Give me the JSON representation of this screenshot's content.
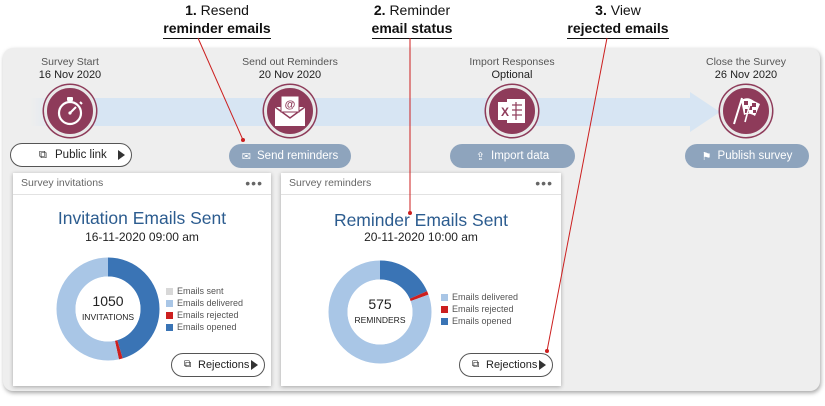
{
  "callouts": [
    {
      "num": "1.",
      "line1": "Resend",
      "bold": "reminder emails"
    },
    {
      "num": "2.",
      "line1": "Reminder",
      "bold": "email status"
    },
    {
      "num": "3.",
      "line1": "View",
      "bold": "rejected emails"
    }
  ],
  "timeline": {
    "stages": [
      {
        "title": "Survey Start",
        "date": "16 Nov 2020",
        "icon": "stopwatch-icon"
      },
      {
        "title": "Send out Reminders",
        "date": "20 Nov 2020",
        "icon": "envelope-at-icon"
      },
      {
        "title": "Import Responses",
        "date": "Optional",
        "icon": "excel-icon"
      },
      {
        "title": "Close the Survey",
        "date": "26 Nov 2020",
        "icon": "checkered-flag-icon"
      }
    ],
    "buttons": {
      "public_link": "Public link",
      "send_reminders": "Send reminders",
      "import_data": "Import data",
      "publish_survey": "Publish survey"
    }
  },
  "invitations_card": {
    "header": "Survey invitations",
    "menu": "•••",
    "title": "Invitation Emails Sent",
    "datetime": "16-11-2020 09:00 am",
    "center_value": "1050",
    "center_label": "INVITATIONS",
    "legend": [
      {
        "label": "Emails sent",
        "color": "#d8d8d8"
      },
      {
        "label": "Emails delivered",
        "color": "#a9c6e6"
      },
      {
        "label": "Emails rejected",
        "color": "#cc1f1f"
      },
      {
        "label": "Emails opened",
        "color": "#3a74b5"
      }
    ],
    "donut_fractions": {
      "delivered": 0.535,
      "rejected": 0.012,
      "opened": 0.453
    },
    "rejections_button": "Rejections"
  },
  "reminders_card": {
    "header": "Survey reminders",
    "menu": "•••",
    "title": "Reminder Emails Sent",
    "datetime": "20-11-2020 10:00 am",
    "center_value": "575",
    "center_label": "REMINDERS",
    "legend": [
      {
        "label": "Emails delivered",
        "color": "#a9c6e6"
      },
      {
        "label": "Emails rejected",
        "color": "#cc1f1f"
      },
      {
        "label": "Emails opened",
        "color": "#3a74b5"
      }
    ],
    "donut_fractions": {
      "delivered": 0.805,
      "rejected": 0.012,
      "opened": 0.183
    },
    "rejections_button": "Rejections"
  },
  "colors": {
    "stage_circle": "#8e3b5a",
    "pill_blue": "#8ea4bd",
    "title_blue": "#2c5c8f"
  }
}
